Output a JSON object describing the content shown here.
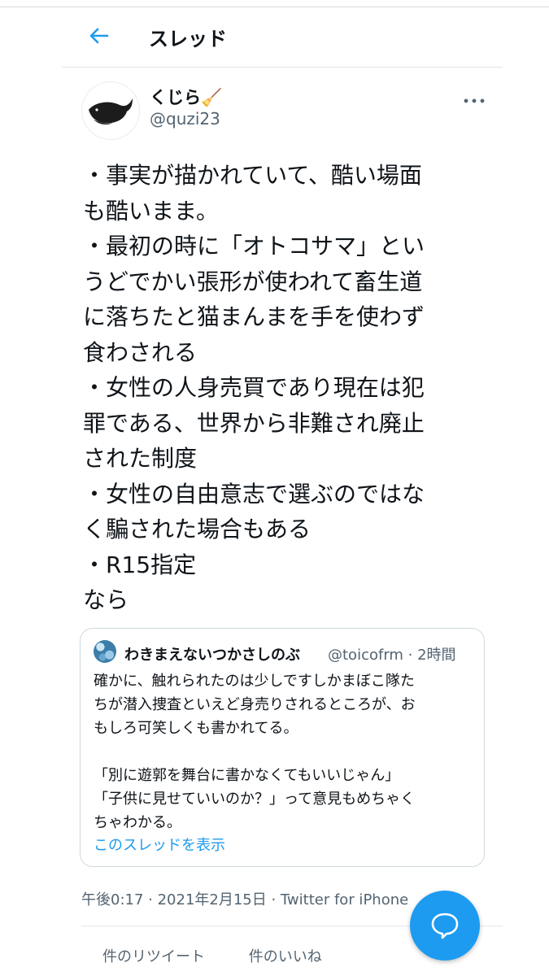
{
  "header": {
    "title": "スレッド",
    "back_icon": "arrow-left-icon"
  },
  "author": {
    "name": "くじら🧹",
    "handle": "@quzi23"
  },
  "tweet": {
    "text": "・事実が描かれていて、酷い場面\nも酷いまま。\n・最初の時に「オトコサマ」とい\nうどでかい張形が使われて畜生道\nに落ちたと猫まんまを手を使わず\n食わされる\n・女性の人身売買であり現在は犯\n罪である、世界から非難され廃止\nされた制度\n・女性の自由意志で選ぶのではな\nく騙された場合もある\n・R15指定\nなら"
  },
  "quoted": {
    "name": "わきまえないつかさしのぶ",
    "meta": "@toicofrm · 2時間",
    "text": "確かに、触れられたのは少しですしかまぼこ隊た\nちが潜入捜査といえど身売りされるところが、お\nもしろ可笑しくも書かれてる。\n\n「別に遊郭を舞台に書かなくてもいいじゃん」\n「子供に見せていいのか？」って意見もめちゃく\nちゃわかる。",
    "link": "このスレッドを表示"
  },
  "meta_line": "午後0:17 · 2021年2月15日 · Twitter for iPhone",
  "stats": {
    "retweets": "件のリツイート",
    "likes": "件のいいね"
  },
  "colors": {
    "accent": "#1d9bf0",
    "secondary_text": "#536471"
  },
  "icons": {
    "more": "more-horizontal-icon",
    "fab": "compose-reply-icon"
  }
}
